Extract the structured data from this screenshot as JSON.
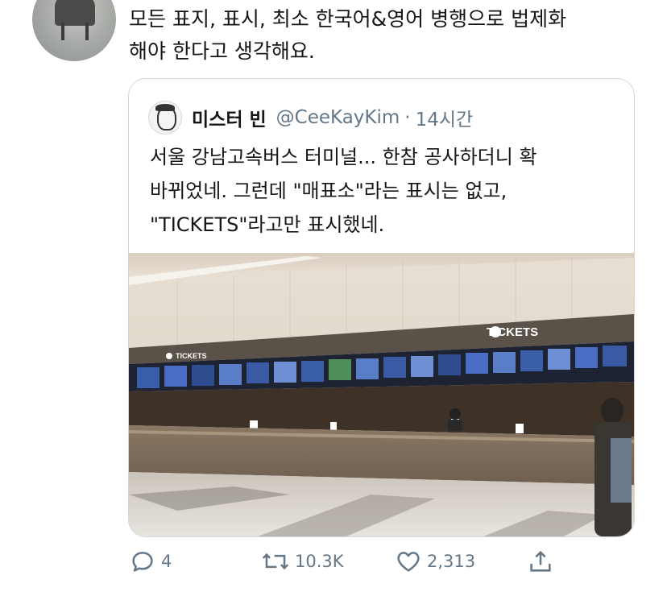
{
  "tweet": {
    "text": "모든 표지, 표시, 최소 한국어&영어 병행으로 법제화\n해야 한다고 생각해요."
  },
  "quote": {
    "name": "미스터 빈",
    "handle": "@CeeKayKim",
    "separator": "·",
    "time": "14시간",
    "text": "서울 강남고속버스 터미널... 한참 공사하더니 확\n바뀌었네. 그런데 \"매표소\"라는 표시는 없고,\n\"TICKETS\"라고만 표시했네.",
    "photo": {
      "sign_large": "TICKETS",
      "sign_small": "TICKETS"
    }
  },
  "actions": {
    "reply_count": "4",
    "retweet_count": "10.3K",
    "like_count": "2,313",
    "reply_icon": "reply-icon",
    "retweet_icon": "retweet-icon",
    "like_icon": "heart-icon",
    "share_icon": "share-icon"
  },
  "colors": {
    "text": "#14171a",
    "secondary": "#657786",
    "border": "#cfd9de"
  }
}
